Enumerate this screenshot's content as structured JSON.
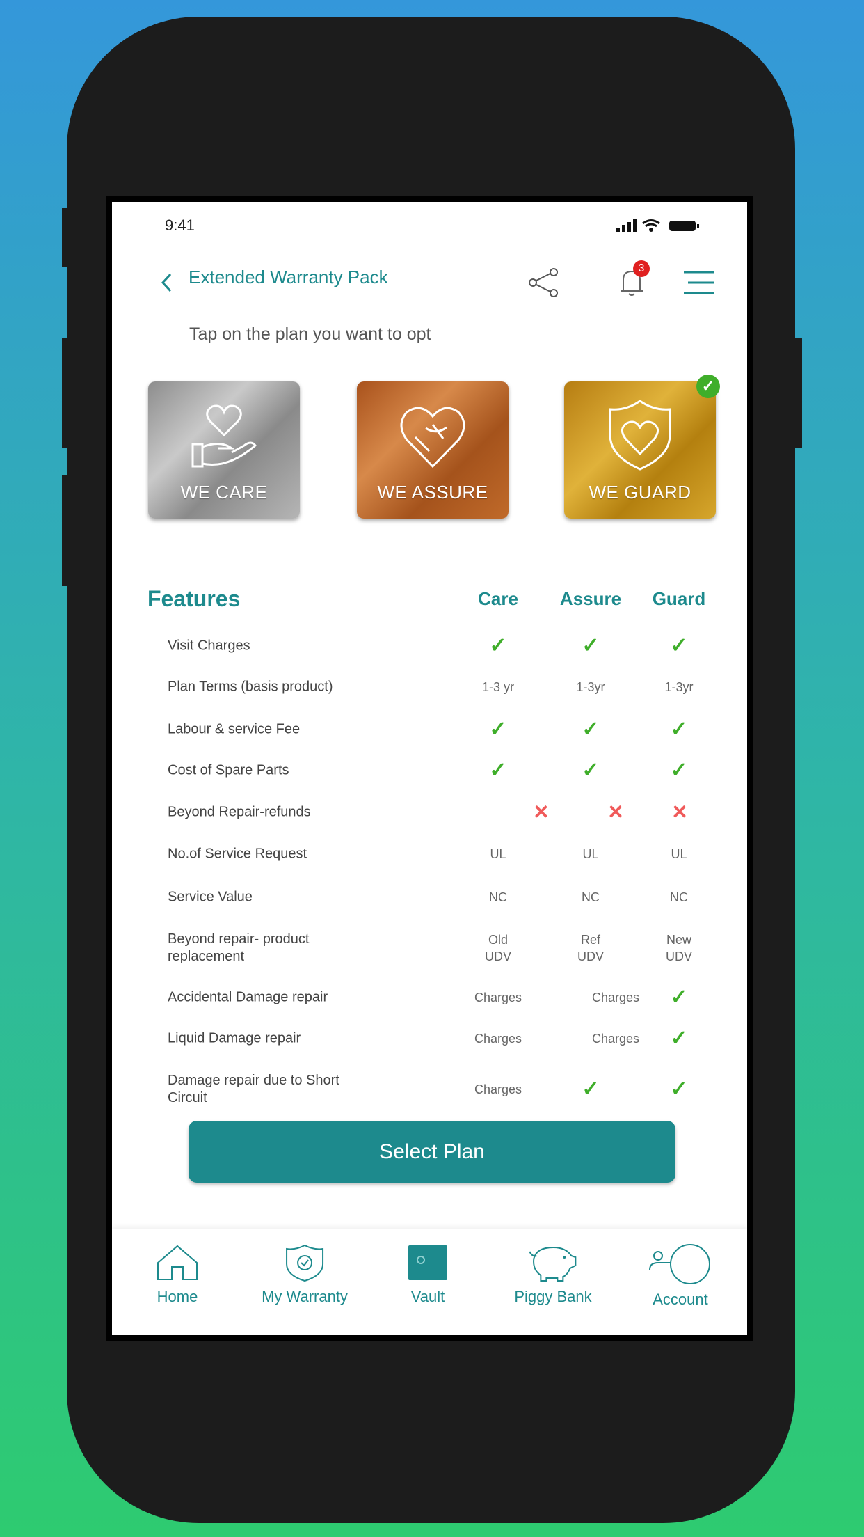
{
  "status_bar": {
    "time": "9:41"
  },
  "header": {
    "title": "Extended Warranty Pack",
    "notification_count": "3"
  },
  "subtitle": "Tap on the plan you want to opt",
  "plans": [
    {
      "label": "WE CARE",
      "icon": "heart-in-hand-icon",
      "selected": false
    },
    {
      "label": "WE ASSURE",
      "icon": "handshake-heart-icon",
      "selected": false
    },
    {
      "label": "WE GUARD",
      "icon": "shield-heart-icon",
      "selected": true
    }
  ],
  "table": {
    "heading": "Features",
    "columns": [
      "Care",
      "Assure",
      "Guard"
    ],
    "rows": [
      {
        "label": "Visit Charges",
        "cells": [
          {
            "icon": "check"
          },
          {
            "icon": "check"
          },
          {
            "icon": "check"
          }
        ]
      },
      {
        "label": "Plan Terms (basis product)",
        "cells": [
          {
            "text": "1-3 yr"
          },
          {
            "text": "1-3yr"
          },
          {
            "text": "1-3yr"
          }
        ]
      },
      {
        "label": "Labour & service Fee",
        "cells": [
          {
            "icon": "check"
          },
          {
            "icon": "check"
          },
          {
            "icon": "check"
          }
        ]
      },
      {
        "label": "Cost of Spare Parts",
        "cells": [
          {
            "icon": "check"
          },
          {
            "icon": "check"
          },
          {
            "icon": "check"
          }
        ]
      },
      {
        "label": "Beyond Repair-refunds",
        "cells": [
          {
            "icon": "cross"
          },
          {
            "icon": "cross"
          },
          {
            "icon": "cross"
          }
        ]
      },
      {
        "label": "No.of Service Request",
        "cells": [
          {
            "text": "UL"
          },
          {
            "text": "UL"
          },
          {
            "text": "UL"
          }
        ]
      },
      {
        "label": "Service Value",
        "cells": [
          {
            "text": "NC"
          },
          {
            "text": "NC"
          },
          {
            "text": "NC"
          }
        ]
      },
      {
        "label": "Beyond repair- product replacement",
        "cells": [
          {
            "text": "Old UDV"
          },
          {
            "text": "Ref UDV"
          },
          {
            "text": "New UDV"
          }
        ]
      },
      {
        "label": "Accidental Damage repair",
        "cells": [
          {
            "text": "Charges"
          },
          {
            "text": "Charges"
          },
          {
            "icon": "check"
          }
        ]
      },
      {
        "label": "Liquid Damage repair",
        "cells": [
          {
            "text": "Charges"
          },
          {
            "text": "Charges"
          },
          {
            "icon": "check"
          }
        ]
      },
      {
        "label": "Damage repair due to Short Circuit",
        "cells": [
          {
            "text": "Charges"
          },
          {
            "icon": "check"
          },
          {
            "icon": "check"
          }
        ]
      }
    ]
  },
  "select_button": "Select Plan",
  "nav": [
    {
      "label": "Home",
      "icon": "home-icon"
    },
    {
      "label": "My Warranty",
      "icon": "shield-check-icon"
    },
    {
      "label": "Vault",
      "icon": "vault-icon"
    },
    {
      "label": "Piggy Bank",
      "icon": "piggy-bank-icon"
    },
    {
      "label": "Account",
      "icon": "account-icon"
    }
  ],
  "colors": {
    "accent": "#1d8a8d",
    "check": "#3fae2a",
    "cross": "#f05a5a",
    "badge": "#e02020"
  }
}
